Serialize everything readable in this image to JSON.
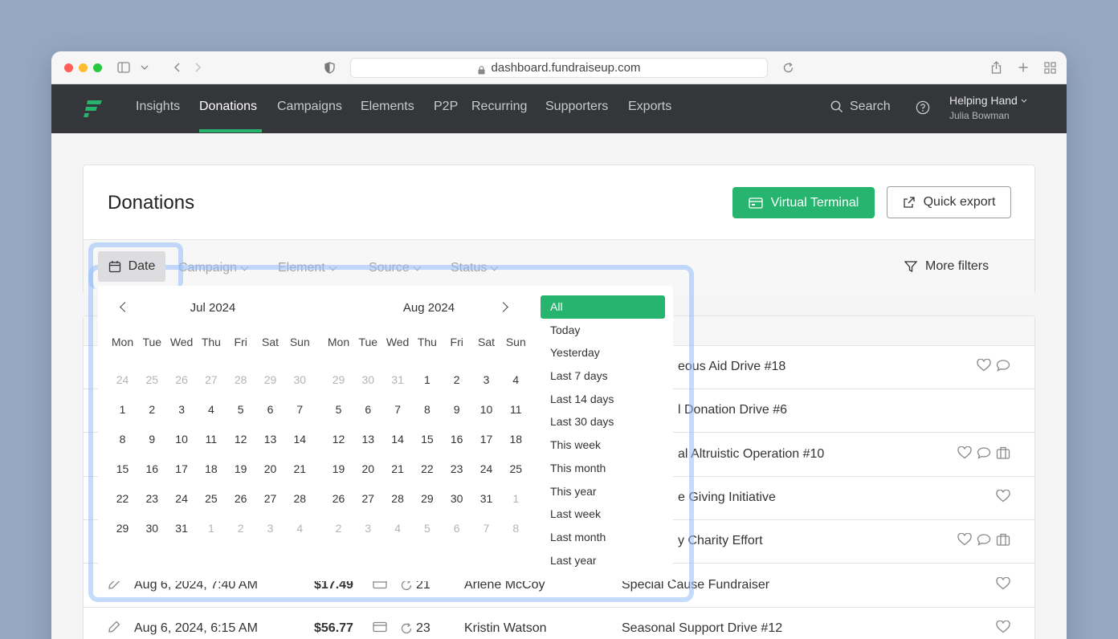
{
  "browser": {
    "url": "dashboard.fundraiseup.com"
  },
  "nav": {
    "items": [
      "Insights",
      "Donations",
      "Campaigns",
      "Elements",
      "P2P",
      "Recurring",
      "Supporters",
      "Exports"
    ],
    "active": "Donations",
    "search_label": "Search",
    "org_name": "Helping Hand",
    "user_name": "Julia Bowman",
    "accent_color": "#26b46e"
  },
  "page": {
    "title": "Donations",
    "virtual_terminal_label": "Virtual Terminal",
    "quick_export_label": "Quick export"
  },
  "filters": {
    "date_label": "Date",
    "campaign_label": "Campaign",
    "element_label": "Element",
    "source_label": "Source",
    "status_label": "Status",
    "more_filters_label": "More filters"
  },
  "datepicker": {
    "weekdays": [
      "Mon",
      "Tue",
      "Wed",
      "Thu",
      "Fri",
      "Sat",
      "Sun"
    ],
    "months": [
      {
        "title": "Jul 2024",
        "weeks": [
          [
            "24",
            "25",
            "26",
            "27",
            "28",
            "29",
            "30"
          ],
          [
            "1",
            "2",
            "3",
            "4",
            "5",
            "6",
            "7"
          ],
          [
            "8",
            "9",
            "10",
            "11",
            "12",
            "13",
            "14"
          ],
          [
            "15",
            "16",
            "17",
            "18",
            "19",
            "20",
            "21"
          ],
          [
            "22",
            "23",
            "24",
            "25",
            "26",
            "27",
            "28"
          ],
          [
            "29",
            "30",
            "31",
            "1",
            "2",
            "3",
            "4"
          ]
        ],
        "out_of_month": [
          [
            0,
            0
          ],
          [
            0,
            1
          ],
          [
            0,
            2
          ],
          [
            0,
            3
          ],
          [
            0,
            4
          ],
          [
            0,
            5
          ],
          [
            0,
            6
          ],
          [
            5,
            3
          ],
          [
            5,
            4
          ],
          [
            5,
            5
          ],
          [
            5,
            6
          ]
        ]
      },
      {
        "title": "Aug 2024",
        "weeks": [
          [
            "29",
            "30",
            "31",
            "1",
            "2",
            "3",
            "4"
          ],
          [
            "5",
            "6",
            "7",
            "8",
            "9",
            "10",
            "11"
          ],
          [
            "12",
            "13",
            "14",
            "15",
            "16",
            "17",
            "18"
          ],
          [
            "19",
            "20",
            "21",
            "22",
            "23",
            "24",
            "25"
          ],
          [
            "26",
            "27",
            "28",
            "29",
            "30",
            "31",
            "1"
          ],
          [
            "2",
            "3",
            "4",
            "5",
            "6",
            "7",
            "8"
          ]
        ],
        "out_of_month": [
          [
            0,
            0
          ],
          [
            0,
            1
          ],
          [
            0,
            2
          ],
          [
            4,
            6
          ],
          [
            5,
            0
          ],
          [
            5,
            1
          ],
          [
            5,
            2
          ],
          [
            5,
            3
          ],
          [
            5,
            4
          ],
          [
            5,
            5
          ],
          [
            5,
            6
          ]
        ]
      }
    ],
    "presets": [
      "All",
      "Today",
      "Yesterday",
      "Last 7 days",
      "Last 14 days",
      "Last 30 days",
      "This week",
      "This month",
      "This year",
      "Last week",
      "Last month",
      "Last year"
    ],
    "selected_preset": "All"
  },
  "table": {
    "rows": [
      {
        "date": "",
        "amount": "",
        "recurring": "",
        "donor": "",
        "campaign": "eous Aid Drive #18",
        "icons": [
          "heart-icon",
          "comment-icon"
        ]
      },
      {
        "date": "",
        "amount": "",
        "recurring": "",
        "donor": "",
        "campaign": "l Donation Drive #6",
        "icons": []
      },
      {
        "date": "",
        "amount": "",
        "recurring": "",
        "donor": "",
        "campaign": "al Altruistic Operation #10",
        "icons": [
          "heart-icon",
          "comment-icon",
          "gift-icon"
        ]
      },
      {
        "date": "",
        "amount": "",
        "recurring": "",
        "donor": "",
        "campaign": "e Giving Initiative",
        "icons": [
          "heart-icon"
        ]
      },
      {
        "date": "",
        "amount": "",
        "recurring": "",
        "donor": "",
        "campaign": "y Charity Effort",
        "icons": [
          "heart-icon",
          "comment-icon",
          "gift-icon"
        ]
      },
      {
        "date": "Aug 6, 2024, 7:40 AM",
        "amount": "$17.49",
        "recurring": "21",
        "donor": "Arlene McCoy",
        "campaign": "Special Cause Fundraiser",
        "icons": [
          "heart-icon"
        ]
      },
      {
        "date": "Aug 6, 2024, 6:15 AM",
        "amount": "$56.77",
        "recurring": "23",
        "donor": "Kristin Watson",
        "campaign": "Seasonal Support Drive #12",
        "icons": [
          "heart-icon"
        ]
      }
    ]
  }
}
